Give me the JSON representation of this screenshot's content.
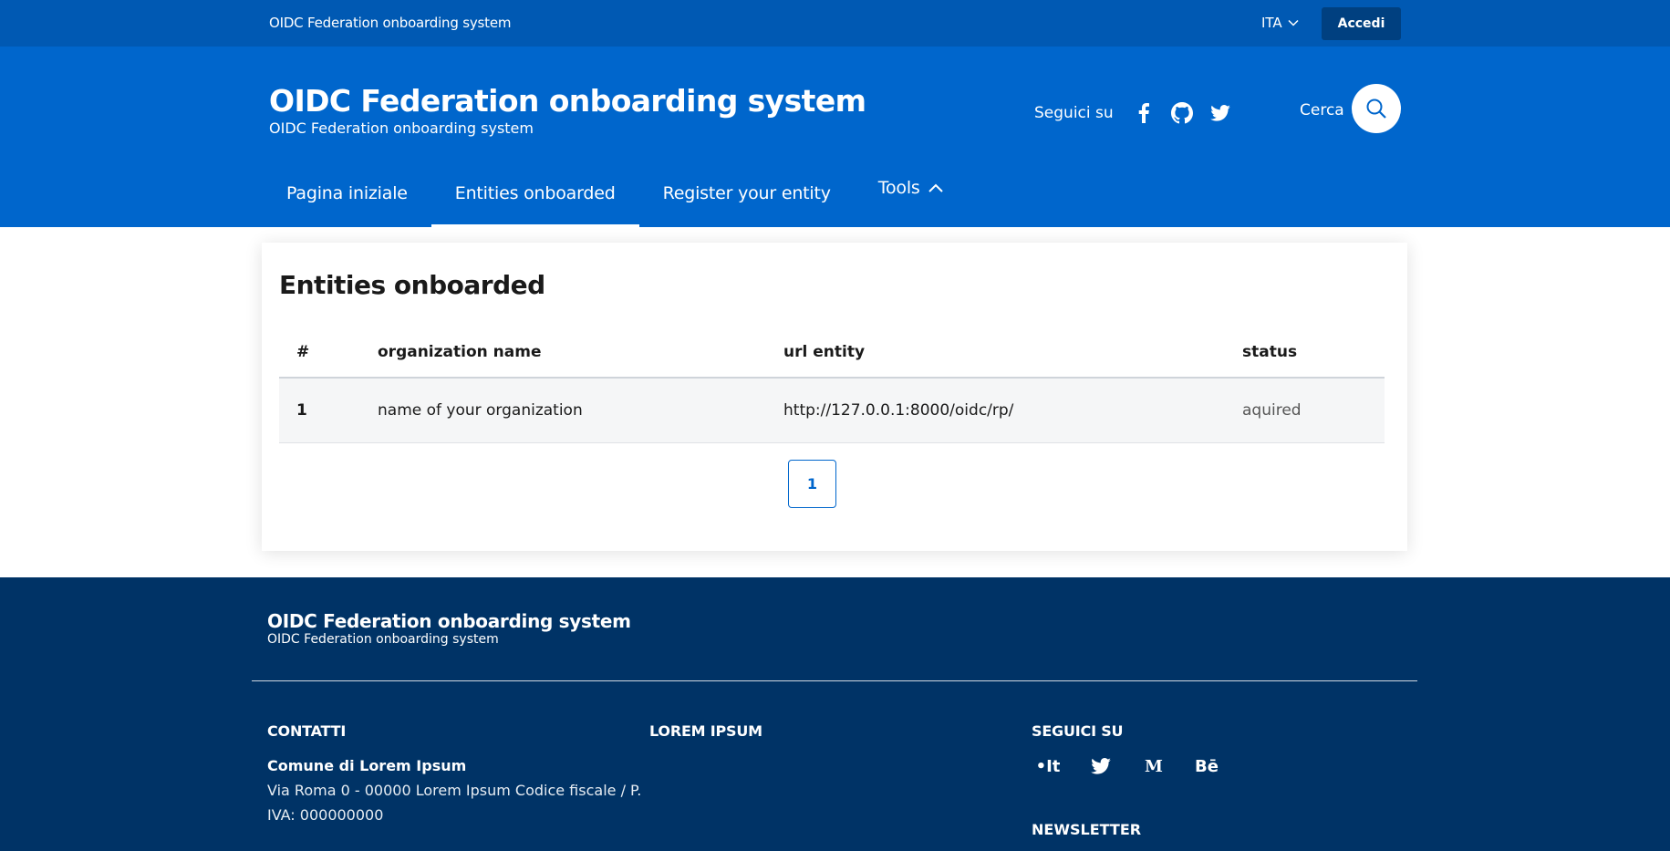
{
  "slim_header": {
    "brand": "OIDC Federation onboarding system",
    "language": "ITA",
    "login_label": "Accedi"
  },
  "header": {
    "title": "OIDC Federation onboarding system",
    "subtitle": "OIDC Federation onboarding system",
    "follow_label": "Seguici su",
    "social_icons": [
      "facebook-icon",
      "github-icon",
      "twitter-icon"
    ],
    "search_label": "Cerca"
  },
  "nav": {
    "items": [
      {
        "label": "Pagina iniziale",
        "active": false
      },
      {
        "label": "Entities onboarded",
        "active": true
      },
      {
        "label": "Register your entity",
        "active": false
      },
      {
        "label": "Tools",
        "active": false
      }
    ]
  },
  "main": {
    "heading": "Entities onboarded",
    "columns": [
      "#",
      "organization name",
      "url entity",
      "status"
    ],
    "rows": [
      {
        "index": "1",
        "organization": "name of your organization",
        "url": "http://127.0.0.1:8000/oidc/rp/",
        "status": "aquired"
      }
    ],
    "pagination": {
      "current_page": "1"
    }
  },
  "footer": {
    "title": "OIDC Federation onboarding system",
    "subtitle": "OIDC Federation onboarding system",
    "contacts_heading": "CONTATTI",
    "contact_name": "Comune di Lorem Ipsum",
    "contact_line1": "Via Roma 0 - 00000 Lorem Ipsum Codice fiscale / P.",
    "contact_line2": "IVA: 000000000",
    "lorem_heading": "LOREM IPSUM",
    "follow_heading": "SEGUICI SU",
    "social": [
      {
        "icon": "designers-italia-icon",
        "glyph": "•It"
      },
      {
        "icon": "twitter-icon",
        "glyph": ""
      },
      {
        "icon": "medium-icon",
        "glyph": "M"
      },
      {
        "icon": "behance-icon",
        "glyph": "Bē"
      }
    ],
    "newsletter_heading": "NEWSLETTER"
  },
  "colors": {
    "slim_bg": "#0059b3",
    "header_bg": "#0066cc",
    "login_bg": "#004080",
    "footer_bg": "#003366",
    "accent": "#0066cc"
  }
}
